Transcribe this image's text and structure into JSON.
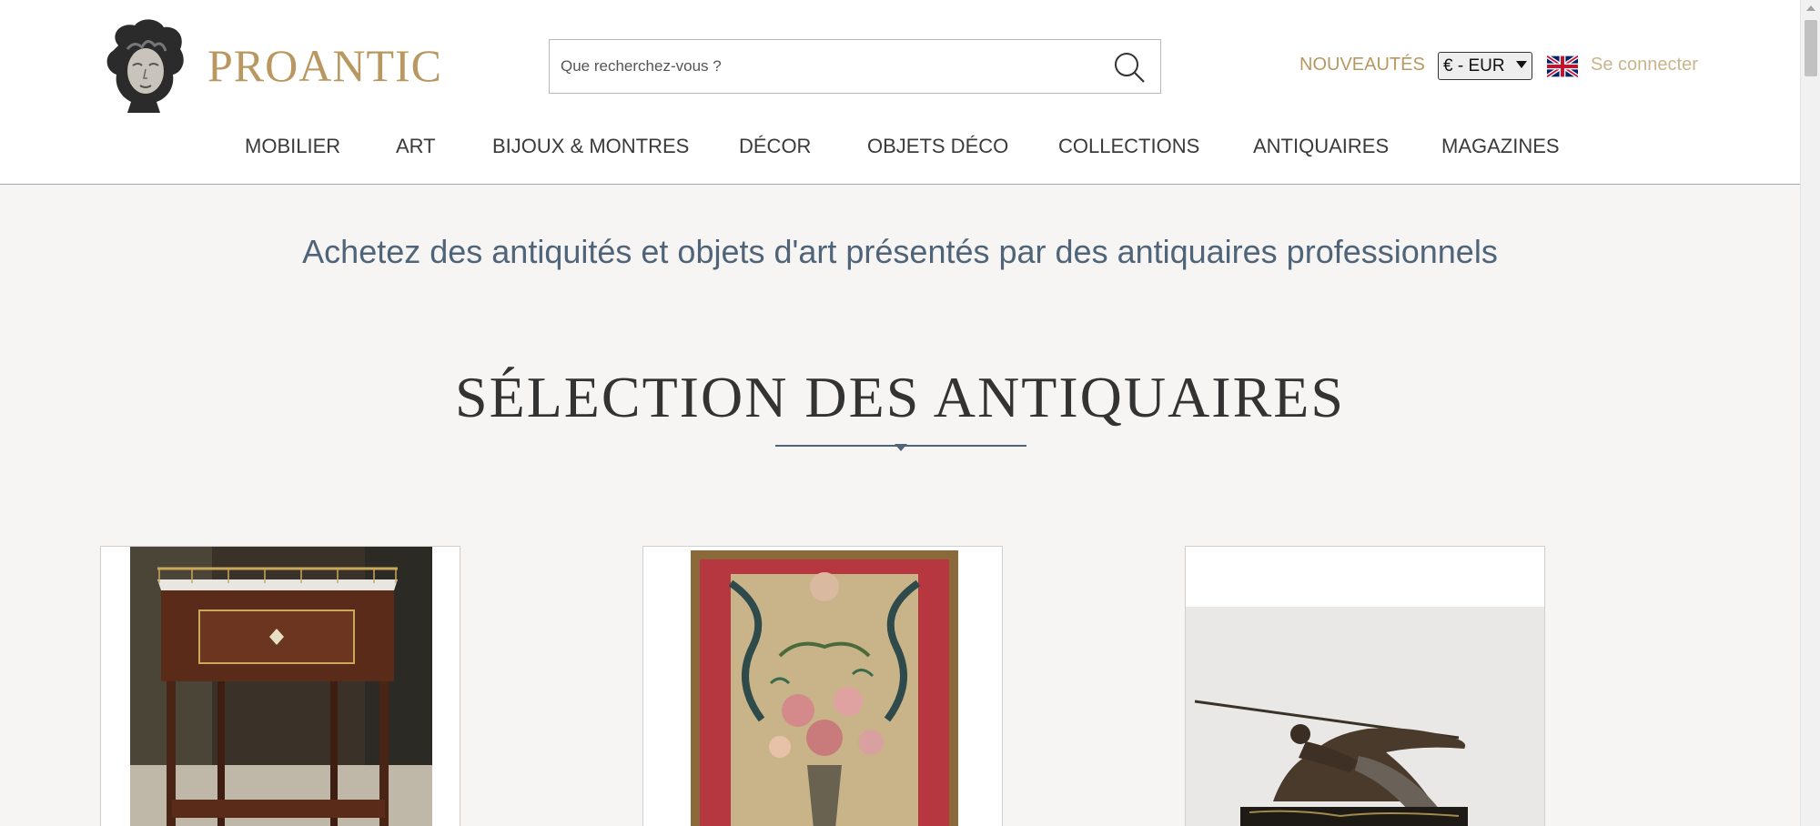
{
  "brand": {
    "name": "PROANTIC"
  },
  "search": {
    "placeholder": "Que recherchez-vous ?"
  },
  "header_links": {
    "nouveautes": "NOUVEAUTÉS",
    "currency": "€ - EUR",
    "login": "Se connecter",
    "language_flag": "uk-flag"
  },
  "nav": {
    "items": [
      {
        "label": "MOBILIER"
      },
      {
        "label": "ART"
      },
      {
        "label": "BIJOUX & MONTRES"
      },
      {
        "label": "DÉCOR"
      },
      {
        "label": "OBJETS DÉCO"
      },
      {
        "label": "COLLECTIONS"
      },
      {
        "label": "ANTIQUAIRES"
      },
      {
        "label": "MAGAZINES"
      }
    ]
  },
  "main": {
    "tagline": "Achetez des antiquités et objets d'art présentés par des antiquaires professionnels",
    "section_title": "SÉLECTION DES ANTIQUAIRES"
  },
  "cards": [
    {
      "image": "louis-xvi-side-table"
    },
    {
      "image": "floral-tapestry-panel"
    },
    {
      "image": "bronze-athlete-sculpture"
    }
  ],
  "colors": {
    "brand_gold": "#b89860",
    "slate_blue": "#4f6478",
    "page_bg": "#f6f5f3"
  }
}
